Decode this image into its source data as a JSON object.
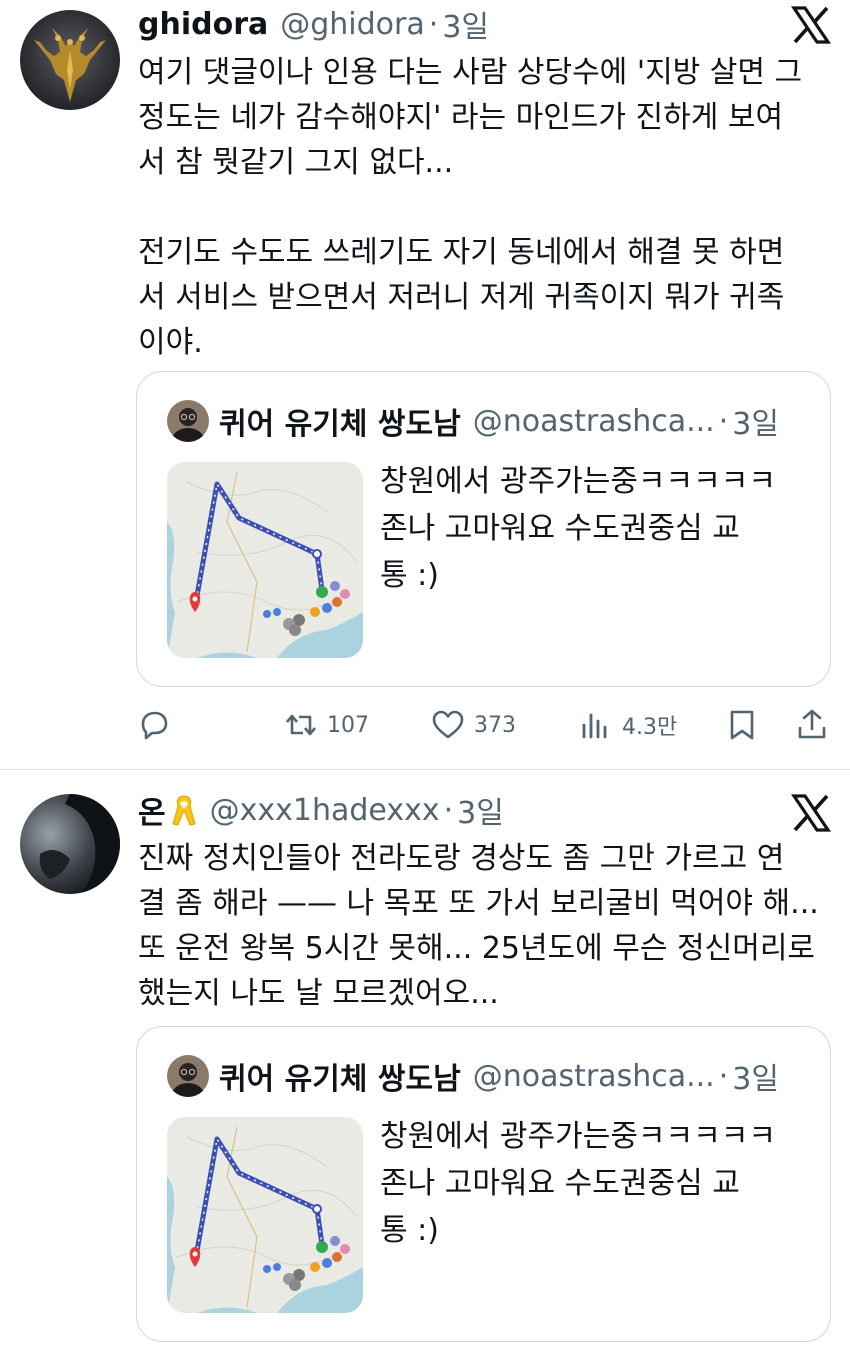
{
  "tweets": [
    {
      "display_name": "ghidora",
      "handle": "@ghidora",
      "separator": "·",
      "time": "3일",
      "text": "여기 댓글이나 인용 다는 사람 상당수에 '지방 살면 그\n정도는 네가 감수해야지' 라는 마인드가 진하게 보여\n서 참 뭣같기 그지 없다...\n\n전기도 수도도 쓰레기도 자기 동네에서 해결 못 하면\n서 서비스 받으면서 저러니 저게 귀족이지 뭐가 귀족\n이야.",
      "avatar_icon": "dragon-avatar",
      "quote": {
        "display_name": "퀴어 유기체 쌍도남",
        "handle": "@noastrashca...",
        "separator": "·",
        "time": "3일",
        "text": "창원에서 광주가는중ㅋㅋㅋㅋㅋ\n존나 고마워요 수도권중심 교\n통 :)"
      },
      "actions": {
        "reply_icon": "reply-icon",
        "retweet_icon": "retweet-icon",
        "retweets": "107",
        "like_icon": "heart-icon",
        "likes": "373",
        "views_icon": "views-icon",
        "views": "4.3만",
        "bookmark_icon": "bookmark-icon",
        "share_icon": "share-icon"
      }
    },
    {
      "display_name": "온",
      "handle": "@xxx1hadexxx",
      "separator": "·",
      "time": "3일",
      "text": "진짜 정치인들아 전라도랑 경상도 좀 그만 가르고 연\n결 좀 해라 —— 나 목포 또 가서 보리굴비 먹어야 해...\n또 운전 왕복 5시간 못해... 25년도에 무슨 정신머리로\n했는지 나도 날 모르겠어오...",
      "avatar_icon": "dark-figure-avatar",
      "name_emoji": "yellow-ribbon-icon",
      "quote": {
        "display_name": "퀴어 유기체 쌍도남",
        "handle": "@noastrashca...",
        "separator": "·",
        "time": "3일",
        "text": "창원에서 광주가는중ㅋㅋㅋㅋㅋ\n존나 고마워요 수도권중심 교\n통 :)"
      }
    }
  ],
  "colors": {
    "text_primary": "#0f1419",
    "text_secondary": "#536471",
    "border": "#cfd9de",
    "route_line": "#3d4fb5",
    "route_marker": "#e23a3a",
    "map_land": "#e8eae3",
    "map_sea": "#aad3df"
  }
}
